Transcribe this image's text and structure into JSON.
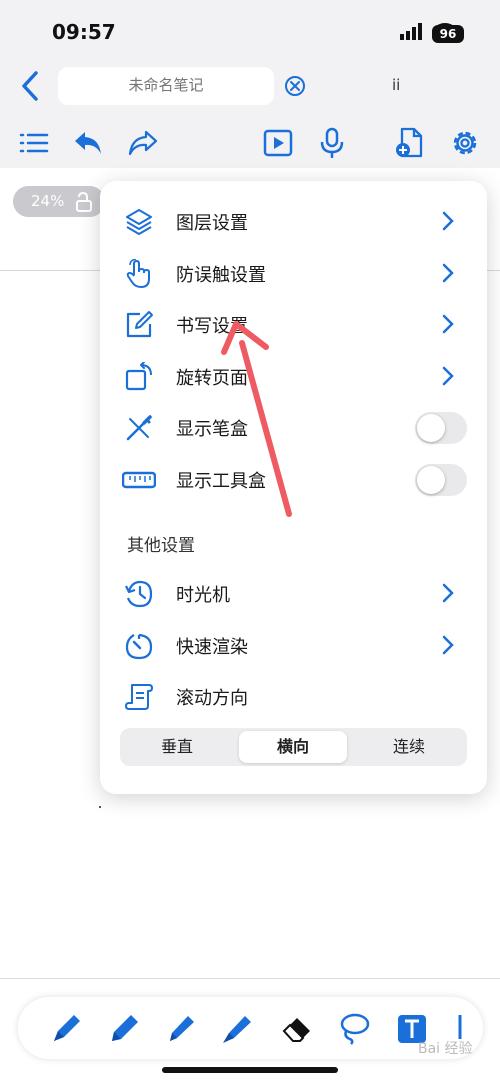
{
  "status_bar": {
    "time": "09:57",
    "battery": "96"
  },
  "header": {
    "title_placeholder": "未命名笔记",
    "handle": "ii"
  },
  "zoom": {
    "value": "24%"
  },
  "menu": {
    "items": [
      {
        "label": "图层设置",
        "icon": "layers-icon",
        "control": "chevron"
      },
      {
        "label": "防误触设置",
        "icon": "touch-hand-icon",
        "control": "chevron"
      },
      {
        "label": "书写设置",
        "icon": "edit-square-icon",
        "control": "chevron"
      },
      {
        "label": "旋转页面",
        "icon": "rotate-page-icon",
        "control": "chevron"
      },
      {
        "label": "显示笔盒",
        "icon": "pencil-crossed-icon",
        "control": "toggle",
        "on": false
      },
      {
        "label": "显示工具盒",
        "icon": "ruler-icon",
        "control": "toggle",
        "on": false
      }
    ],
    "section_title": "其他设置",
    "other_items": [
      {
        "label": "时光机",
        "icon": "history-clock-icon",
        "control": "chevron"
      },
      {
        "label": "快速渲染",
        "icon": "fast-render-icon",
        "control": "chevron"
      },
      {
        "label": "滚动方向",
        "icon": "scroll-icon",
        "control": "none"
      }
    ],
    "scroll_direction": {
      "options": [
        "垂直",
        "横向",
        "连续"
      ],
      "selected": "横向"
    }
  },
  "watermark": "Bai 经验",
  "colors": {
    "accent": "#1b6fd8",
    "annotation_arrow": "#ef5b62"
  }
}
